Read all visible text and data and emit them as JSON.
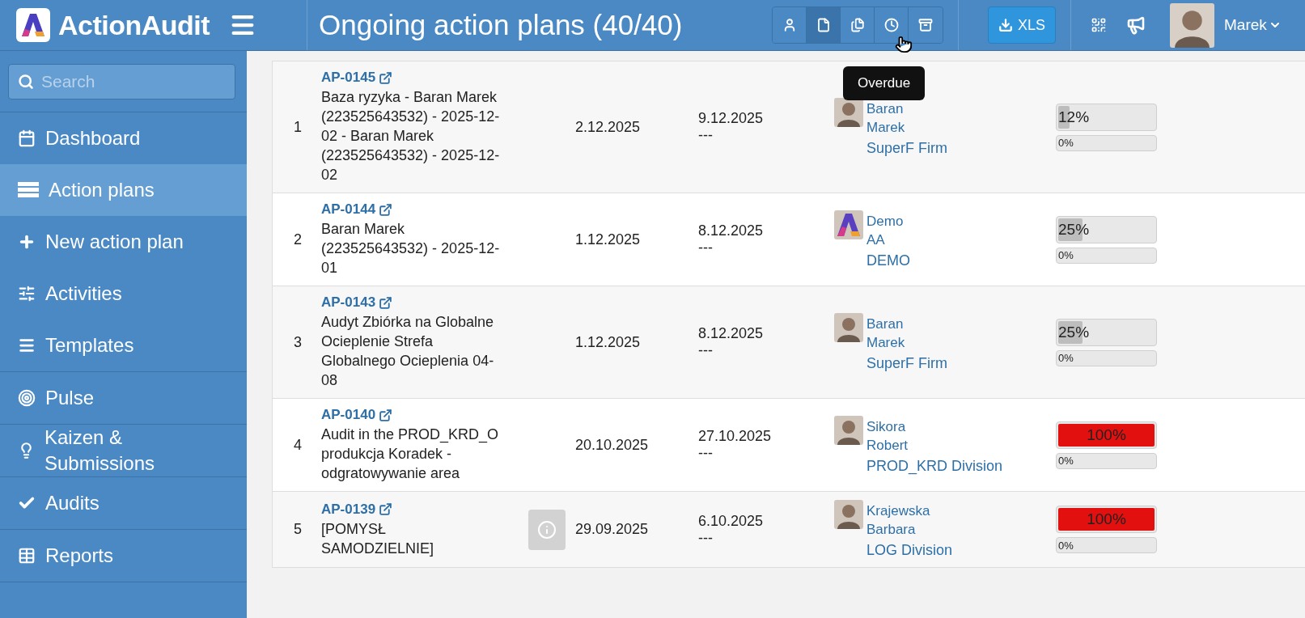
{
  "header": {
    "logo": "ActionAudit",
    "title": "Ongoing action plans (40/40)",
    "view_buttons": [
      {
        "kind": "user",
        "selected": false
      },
      {
        "kind": "file",
        "selected": true
      },
      {
        "kind": "files",
        "selected": false
      },
      {
        "kind": "clock",
        "selected": false
      },
      {
        "kind": "archive",
        "selected": false
      }
    ],
    "export_button": "XLS",
    "user_name": "Marek"
  },
  "tooltip": "Overdue",
  "sidebar": {
    "search": {
      "placeholder": "Search"
    },
    "groups": [
      [
        {
          "kind": "calendar",
          "label": "Dashboard",
          "selected": false
        },
        {
          "kind": "rows",
          "label": "Action plans",
          "selected": true
        },
        {
          "kind": "plus",
          "label": "New action plan",
          "selected": false
        },
        {
          "kind": "sliders",
          "label": "Activities",
          "selected": false
        },
        {
          "kind": "list",
          "label": "Templates",
          "selected": false
        }
      ],
      [
        {
          "kind": "target",
          "label": "Pulse",
          "selected": false
        }
      ],
      [
        {
          "kind": "bulb",
          "label": "Kaizen & Submissions",
          "selected": false
        }
      ],
      [
        {
          "kind": "check",
          "label": "Audits",
          "selected": false
        }
      ],
      [
        {
          "kind": "table",
          "label": "Reports",
          "selected": false
        }
      ]
    ]
  },
  "rows": [
    {
      "number": "1",
      "code": "AP-0145",
      "description": "Baza ryzyka - Baran Marek (223525643532) - 2025-12-02 - Baran Marek (223525643532) - 2025-12-02",
      "info": false,
      "start": "2.12.2025",
      "due": "9.12.2025",
      "closed": "---",
      "kind": "person",
      "owner": "Baran Marek",
      "unit": "SuperF Firm",
      "progress": {
        "label": "12%",
        "level": 0.12,
        "overdue": false
      },
      "sub_progress": {
        "label": "0%"
      }
    },
    {
      "number": "2",
      "code": "AP-0144",
      "description": "Baran Marek (223525643532) - 2025-12-01",
      "info": false,
      "start": "1.12.2025",
      "due": "8.12.2025",
      "closed": "---",
      "kind": "logo",
      "owner": "Demo AA",
      "unit": "DEMO",
      "progress": {
        "label": "25%",
        "level": 0.25,
        "overdue": false
      },
      "sub_progress": {
        "label": "0%"
      }
    },
    {
      "number": "3",
      "code": "AP-0143",
      "description": "Audyt Zbiórka na Globalne Ocieplenie Strefa Globalnego Ocieplenia 04-08",
      "info": false,
      "start": "1.12.2025",
      "due": "8.12.2025",
      "closed": "---",
      "kind": "person",
      "owner": "Baran Marek",
      "unit": "SuperF Firm",
      "progress": {
        "label": "25%",
        "level": 0.25,
        "overdue": false
      },
      "sub_progress": {
        "label": "0%"
      }
    },
    {
      "number": "4",
      "code": "AP-0140",
      "description": "Audit in the PROD_KRD_O produkcja Koradek - odgratowywanie area",
      "info": false,
      "start": "20.10.2025",
      "due": "27.10.2025",
      "closed": "---",
      "kind": "person",
      "owner": "Sikora Robert",
      "unit": "PROD_KRD Division",
      "progress": {
        "label": "100%",
        "level": 1,
        "overdue": true
      },
      "sub_progress": {
        "label": "0%"
      }
    },
    {
      "number": "5",
      "code": "AP-0139",
      "description": "[POMYSŁ SAMODZIELNIE]",
      "info": true,
      "start": "29.09.2025",
      "due": "6.10.2025",
      "closed": "---",
      "kind": "person",
      "owner": "Krajewska Barbara",
      "unit": "LOG Division",
      "progress": {
        "label": "100%",
        "level": 1,
        "overdue": true
      },
      "sub_progress": {
        "label": "0%"
      }
    }
  ]
}
